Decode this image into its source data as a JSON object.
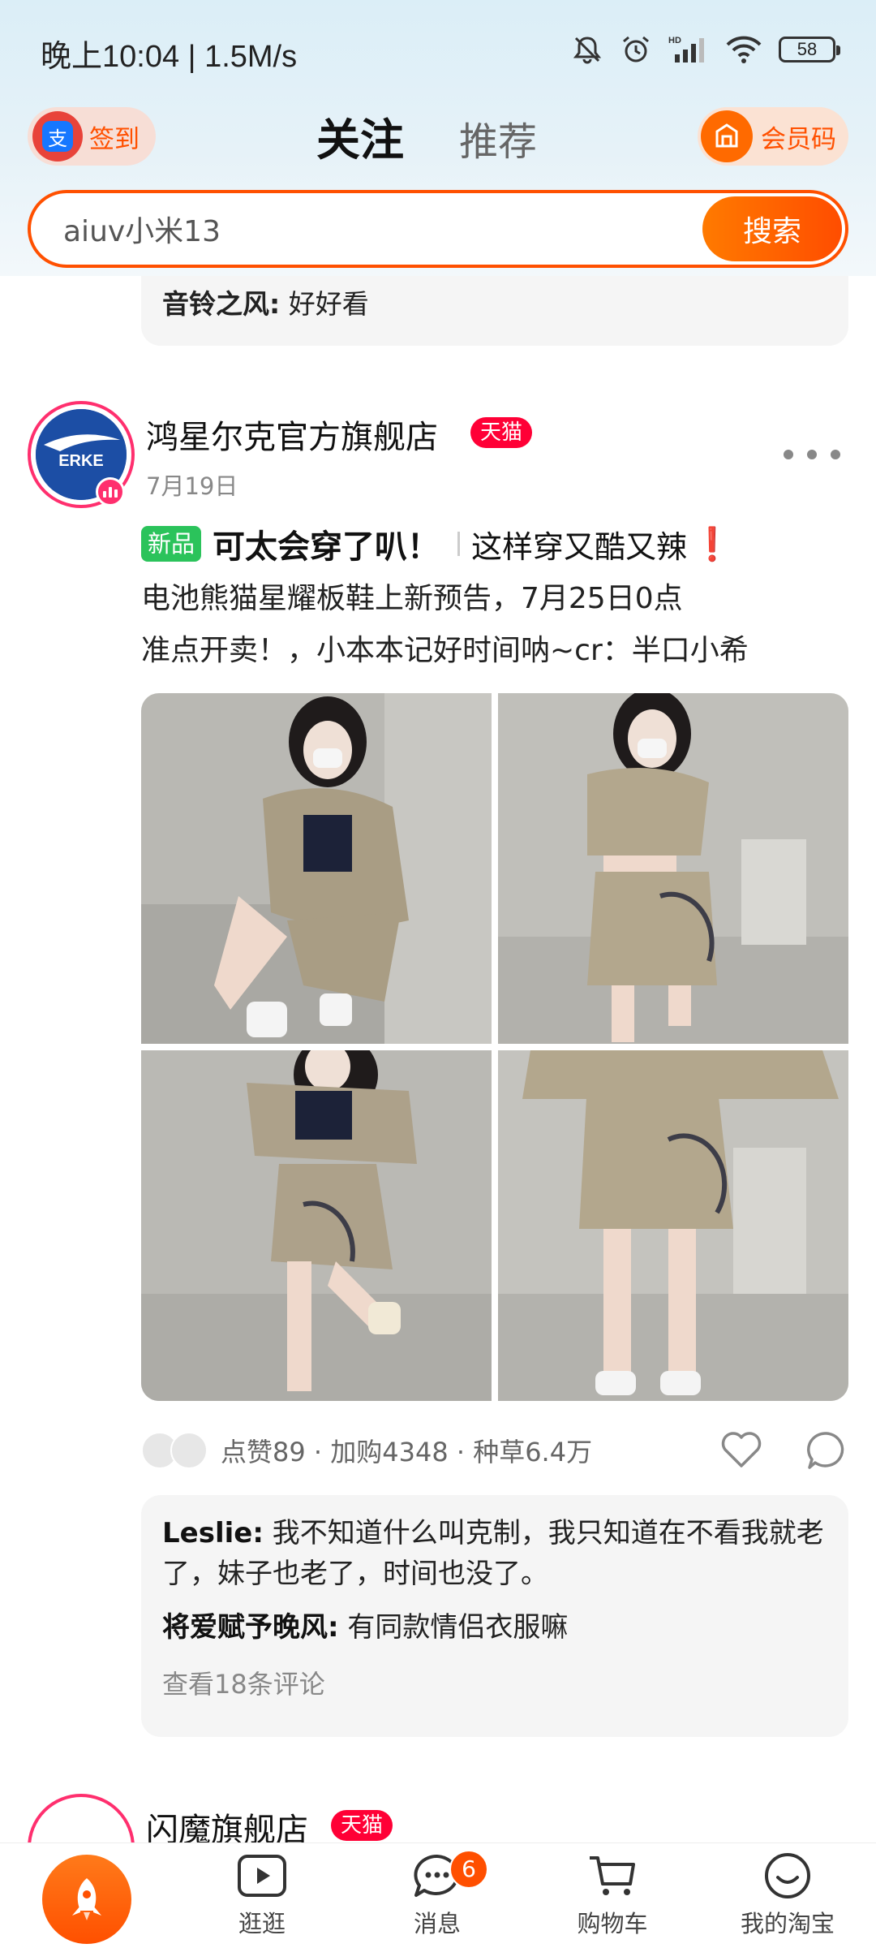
{
  "status_bar": {
    "time_speed": "晚上10:04 | 1.5M/s",
    "battery": "58"
  },
  "header": {
    "signin_label": "签到",
    "tabs": [
      {
        "label": "关注",
        "active": true
      },
      {
        "label": "推荐",
        "active": false
      }
    ],
    "member_label": "会员码"
  },
  "search": {
    "value": "aiuv小米13",
    "button_label": "搜索"
  },
  "previous_post": {
    "comment_user": "音铃之风:",
    "comment_text": " 好好看"
  },
  "post": {
    "store_name": "鸿星尔克官方旗舰店",
    "store_badge": "天猫",
    "date": "7月19日",
    "new_badge": "新品",
    "title": "可太会穿了叭！",
    "subtitle": "这样穿又酷又辣",
    "exclaim": "❗",
    "body_line1": "电池熊猫星耀板鞋上新预告，7月25日0点",
    "body_line2": "准点开卖！，小本本记好时间呐~cr：半口小希",
    "stats": "点赞89 · 加购4348 · 种草6.4万",
    "comments": [
      {
        "user": "Leslie:",
        "text": " 我不知道什么叫克制，我只知道在不看我就老了，妹子也老了，时间也没了。"
      },
      {
        "user": "将爱赋予晚风:",
        "text": " 有同款情侣衣服嘛"
      }
    ],
    "view_all_comments": "查看18条评论",
    "avatar_logo_text": "ERKE"
  },
  "next_post": {
    "store_name": "闪魔旗舰店",
    "store_badge": "天猫"
  },
  "bottom_nav": {
    "items": [
      {
        "label": "逛逛",
        "icon": "play-icon"
      },
      {
        "label": "消息",
        "icon": "chat-icon",
        "badge": "6"
      },
      {
        "label": "购物车",
        "icon": "cart-icon"
      },
      {
        "label": "我的淘宝",
        "icon": "smile-icon"
      }
    ]
  },
  "colors": {
    "brand_orange": "#ff5000",
    "tmall_red": "#ff0036",
    "new_green": "#2bc35b"
  }
}
